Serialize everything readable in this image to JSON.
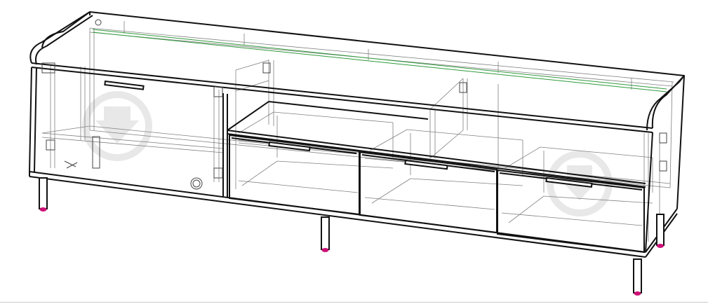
{
  "drawing": {
    "subject": "tv-stand-wireframe",
    "colors": {
      "outline": "#111111",
      "hidden_line": "#7a7a7a",
      "guide_line": "#2e9a3a",
      "foot_cap": "#cc1177",
      "watermark": "#d9d9d9",
      "background": "#ffffff"
    },
    "parts": {
      "doors": 1,
      "drawers": 3,
      "open_compartments": 2,
      "legs": 5
    },
    "watermark_icon": "download-arrow-icon"
  }
}
